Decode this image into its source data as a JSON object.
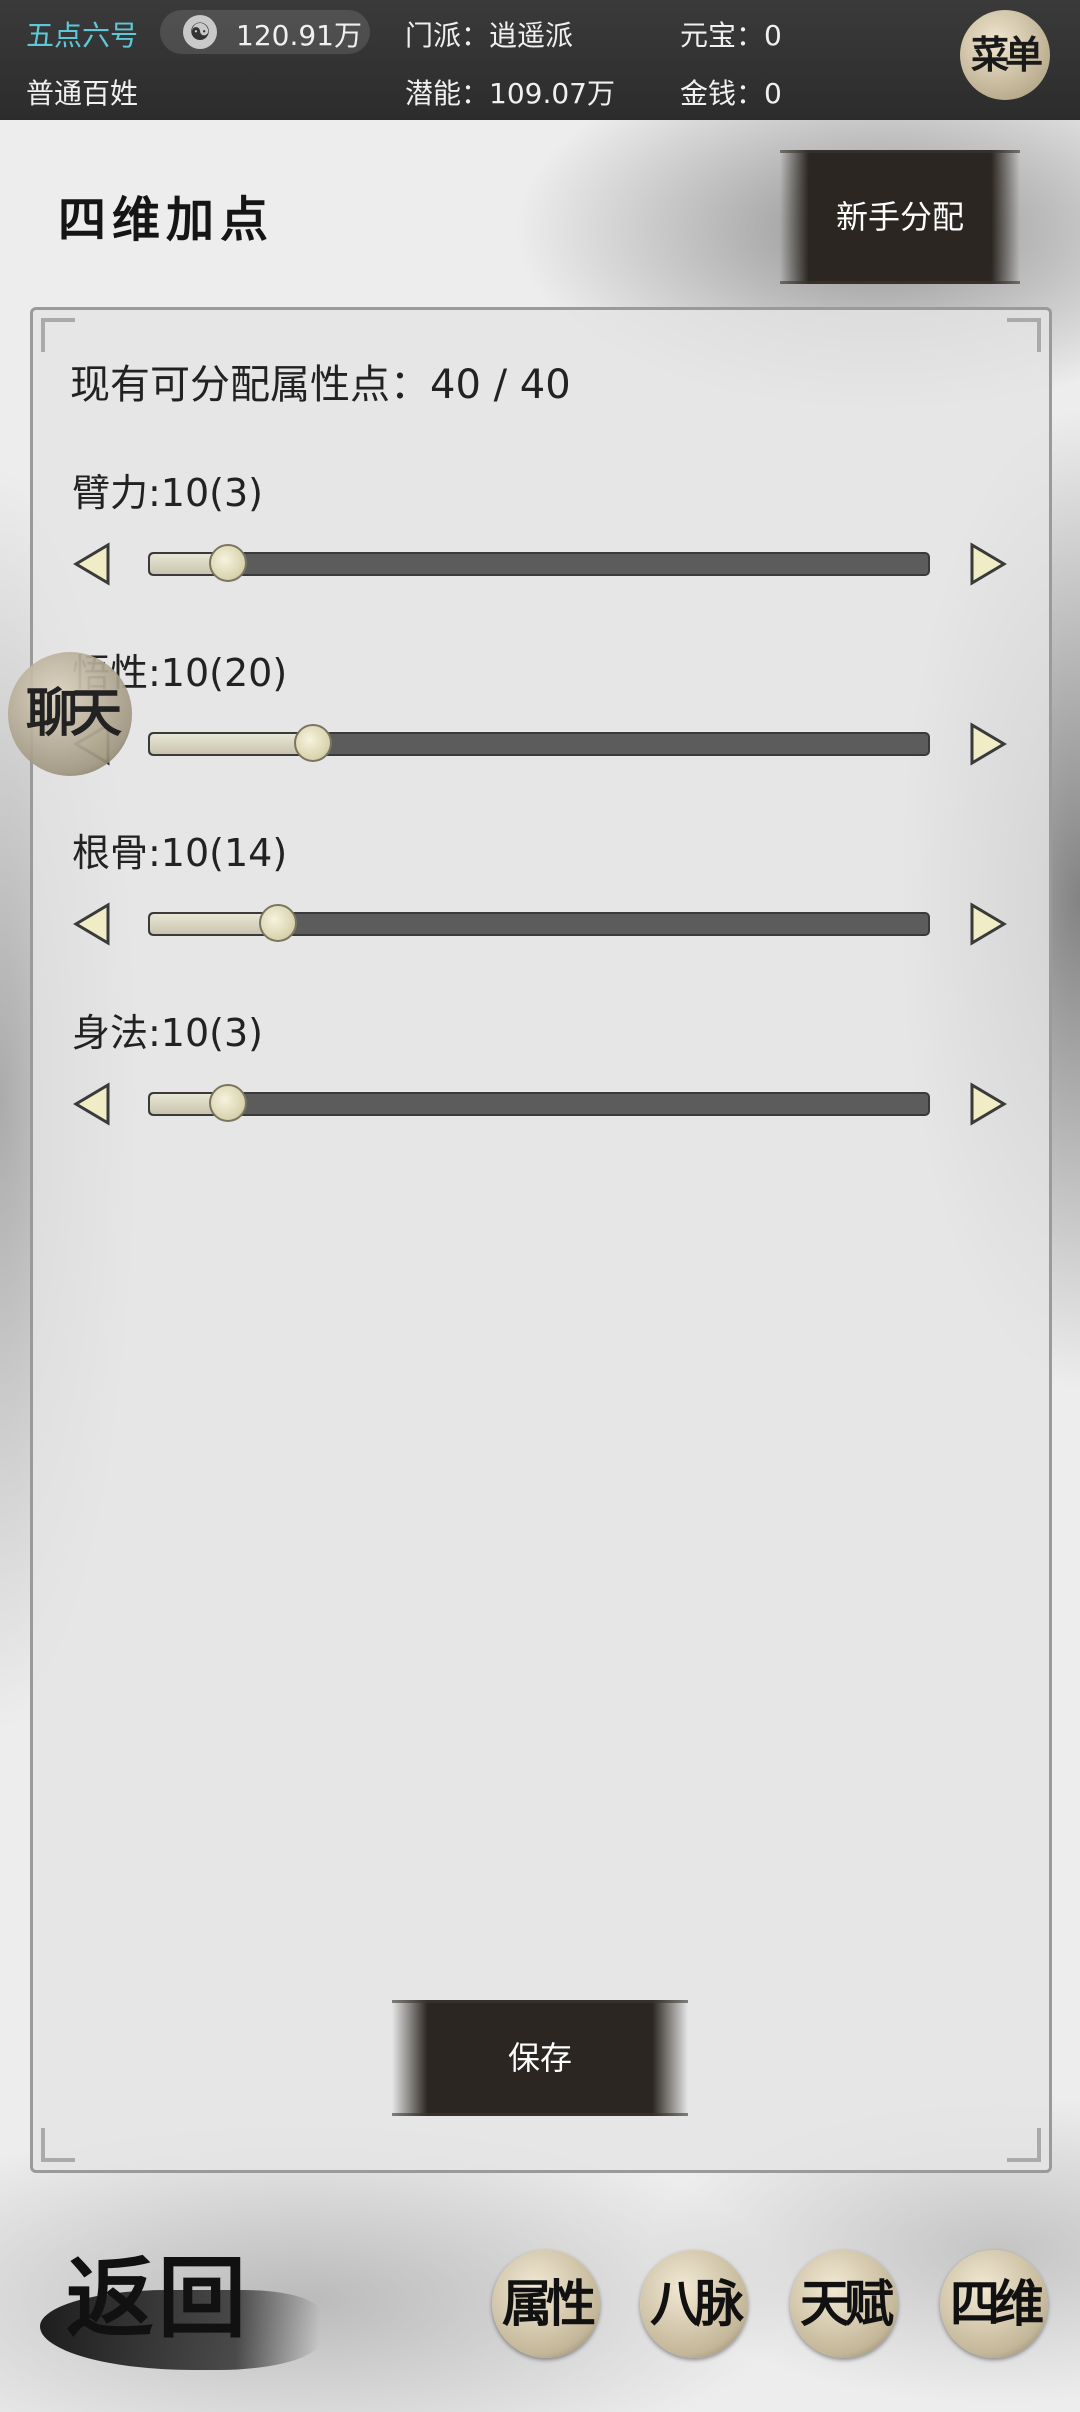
{
  "topbar": {
    "player_name": "五点六号",
    "coin_value": "120.91万",
    "rank": "普通百姓",
    "sect_label": "门派：",
    "sect_value": "逍遥派",
    "potential_label": "潜能：",
    "potential_value": "109.07万",
    "yuanbao_label": "元宝：",
    "yuanbao_value": "0",
    "money_label": "金钱：",
    "money_value": "0",
    "menu_label": "菜单"
  },
  "header": {
    "title": "四维加点",
    "novice_button": "新手分配"
  },
  "panel": {
    "available_label": "现有可分配属性点：",
    "available_value": "40 / 40",
    "stats": [
      {
        "label": "臂力:10(3)",
        "level": 0.1
      },
      {
        "label": "悟性:10(20)",
        "level": 0.21
      },
      {
        "label": "根骨:10(14)",
        "level": 0.165
      },
      {
        "label": "身法:10(3)",
        "level": 0.1
      }
    ],
    "save_button": "保存"
  },
  "chat_button": "聊天",
  "bottom": {
    "back": "返回",
    "tabs": [
      "属性",
      "八脉",
      "天赋",
      "四维"
    ]
  },
  "colors": {
    "topbar_bg": "#2c2c2c",
    "name_color": "#5ec8d8",
    "button_dark": "#2b2621"
  }
}
